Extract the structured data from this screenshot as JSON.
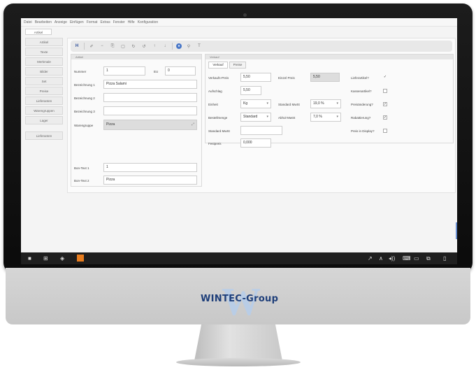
{
  "menubar": [
    "Datei",
    "Bearbeiten",
    "Anzeige",
    "Einfügen",
    "Format",
    "Extras",
    "Fenster",
    "Hilfe",
    "Konfiguration"
  ],
  "document_tab": "Artikel",
  "sidebar": {
    "items": [
      "Artikel",
      "Texte",
      "Merkmale",
      "Bilder",
      "Set",
      "Preise",
      "Lieferanten",
      "Warengruppen",
      "Lager"
    ],
    "footer_item": "Lieferanten"
  },
  "toolbar": {
    "icons": [
      "save-icon",
      "edit-icon",
      "minus-icon",
      "copy-icon",
      "document-icon",
      "refresh-icon",
      "undo-icon",
      "arrow-up-icon",
      "arrow-down-icon",
      "select-icon",
      "user-icon",
      "text-icon"
    ],
    "glyphs": [
      "H",
      "✐",
      "−",
      "⎘",
      "▢",
      "↻",
      "↺",
      "↑",
      "↓",
      "●",
      "⚲",
      "T"
    ]
  },
  "left_panel": {
    "header": "Artikel",
    "nummer_label": "Nummer",
    "nummer_value": "1",
    "ean_label": "EU",
    "ean_value": "0",
    "bez1_label": "Bezeichnung 1",
    "bez1_value": "Pizza Salami",
    "bez2_label": "Bezeichnung 2",
    "bez2_value": "",
    "bez3_label": "Bezeichnung 3",
    "bez3_value": "",
    "warengruppe_label": "Warengruppe",
    "warengruppe_value": "Pizza",
    "bon1_label": "Bon-Text 1",
    "bon1_value": "1",
    "bon2_label": "Bon-Text 2",
    "bon2_value": "Pizza"
  },
  "right_panel": {
    "header": "Verkauf",
    "tabs": [
      "Verkauf",
      "Preise"
    ],
    "vkpreis_label": "Verkaufs-Preis",
    "vkpreis_value": "5,50",
    "ekpreis_label": "Einzel Preis",
    "ekpreis_value": "5,50",
    "aufschlag_label": "Aufschlag",
    "aufschlag_value": "5,50",
    "einheit_label": "Einheit",
    "einheit_value": "Kg",
    "bestellmenge_label": "Bestellmenge",
    "bestellmenge_value": "Standard",
    "standard_mwst_label": "Standard MwSt",
    "standard_mwst_value": "19,0 %",
    "abhol_mwst_label": "Abhol-MwSt",
    "abhol_mwst_value": "7,0 %",
    "standard_ust_label": "Standard MwSt",
    "standard_ust_value": "",
    "festpreis_label": "Festpreis",
    "festpreis_value": "0,000",
    "checks": [
      {
        "label": "Lieferartikel?",
        "mark": "✓",
        "boxed": false
      },
      {
        "label": "Kassenartikel?",
        "mark": "",
        "boxed": true
      },
      {
        "label": "Preisänderung?",
        "mark": "✓",
        "boxed": true
      },
      {
        "label": "Rabattierung?",
        "mark": "✓",
        "boxed": true
      },
      {
        "label": "Preis in Display?",
        "mark": "",
        "boxed": true
      }
    ]
  },
  "taskbar": {
    "left_icons": [
      "■",
      "⊞",
      "◈"
    ],
    "right_icons": [
      "↗",
      "∧",
      "◂))",
      "⌨",
      "▭",
      "⧉",
      "▯"
    ]
  },
  "brand": {
    "logo_text": "WINTEC-Group",
    "logo_letter": "W",
    "primary_color": "#1f3f7a",
    "accent_color": "#b9cde6"
  }
}
